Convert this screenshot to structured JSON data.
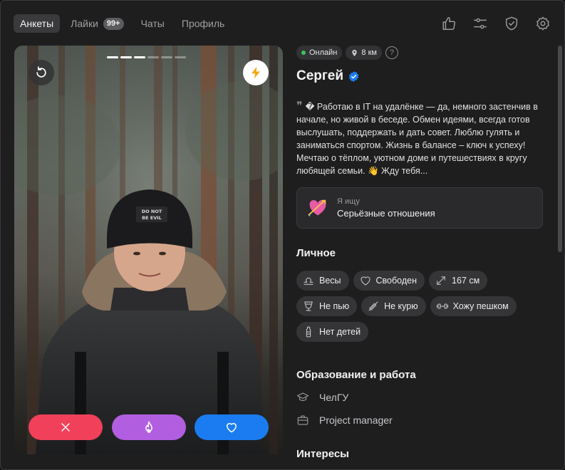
{
  "nav": {
    "tabs": [
      {
        "label": "Анкеты"
      },
      {
        "label": "Лайки",
        "badge": "99+"
      },
      {
        "label": "Чаты"
      },
      {
        "label": "Профиль"
      }
    ],
    "icons": [
      "thumb-up-icon",
      "sliders-icon",
      "shield-icon",
      "gear-icon"
    ]
  },
  "photo": {
    "photo_count": 6,
    "current_index": 3,
    "hat_text": "DO NOT BE EVIL",
    "actions": [
      "dislike",
      "super-like",
      "like"
    ]
  },
  "profile": {
    "online": "Онлайн",
    "distance": "8 км",
    "name": "Сергей",
    "bio": "� Работаю в IT на удалёнке — да, немного застенчив в начале, но живой в беседе. Обмен идеями, всегда готов выслушать, поддержать и дать совет. Люблю гулять и заниматься спортом. Жизнь в балансе – ключ к успеху! Мечтаю о тёплом, уютном доме и путешествиях в кругу любящей семьи. 👋 Жду тебя...",
    "seeking": {
      "label": "Я ищу",
      "value": "Серьёзные отношения"
    }
  },
  "personal": {
    "title": "Личное",
    "chips": [
      {
        "label": "Весы",
        "icon": "libra-icon"
      },
      {
        "label": "Свободен",
        "icon": "heart-icon"
      },
      {
        "label": "167 см",
        "icon": "height-icon"
      },
      {
        "label": "Не пью",
        "icon": "glass-icon"
      },
      {
        "label": "Не курю",
        "icon": "no-smoking-icon"
      },
      {
        "label": "Хожу пешком",
        "icon": "dumbbell-icon"
      },
      {
        "label": "Нет детей",
        "icon": "bottle-icon"
      }
    ]
  },
  "education": {
    "title": "Образование и работа",
    "school": "ЧелГУ",
    "job": "Project manager"
  },
  "interests": {
    "title": "Интересы"
  },
  "colors": {
    "accent": "#1a7cf0",
    "dislike": "#f0405a",
    "super": "#b25ee0",
    "online": "#3bc55c"
  }
}
